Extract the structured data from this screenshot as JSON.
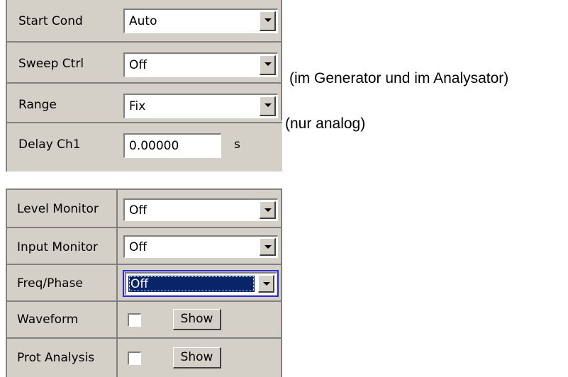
{
  "panel1": {
    "start_cond": {
      "label": "Start Cond",
      "value": "Auto"
    },
    "sweep_ctrl": {
      "label": "Sweep Ctrl",
      "value": "Off"
    },
    "range": {
      "label": "Range",
      "value": "Fix"
    },
    "delay_ch1": {
      "label": "Delay Ch1",
      "value": "0.00000",
      "unit": "s"
    }
  },
  "notes": {
    "sweep_ctrl_note": "(im Generator und im Analysator)",
    "range_note": "(nur analog)"
  },
  "panel2": {
    "level_monitor": {
      "label": "Level Monitor",
      "value": "Off"
    },
    "input_monitor": {
      "label": "Input Monitor",
      "value": "Off"
    },
    "freq_phase": {
      "label": "Freq/Phase",
      "value": "Off"
    },
    "waveform": {
      "label": "Waveform",
      "checked": false,
      "button": "Show"
    },
    "prot_analysis": {
      "label": "Prot Analysis",
      "checked": false,
      "button": "Show"
    }
  },
  "colors": {
    "panel_bg": "#d4d0c8",
    "selection": "#0a246a",
    "focus_border": "#2a2ad6"
  }
}
